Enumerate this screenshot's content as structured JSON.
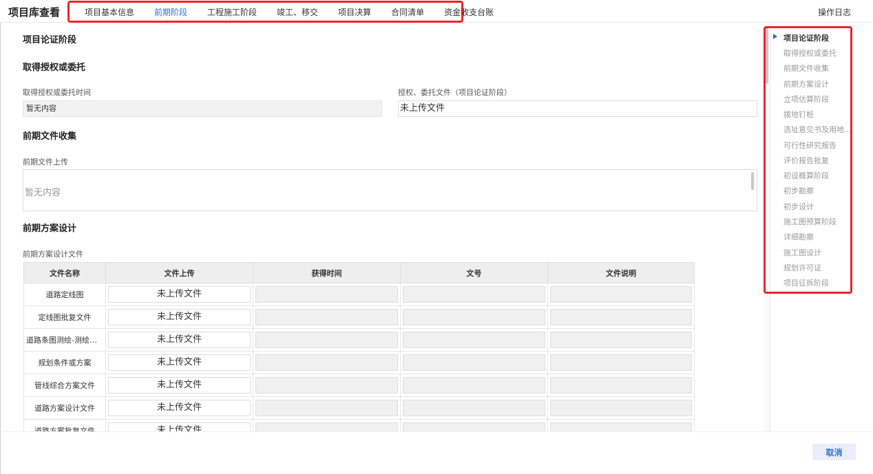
{
  "header": {
    "title": "项目库查看",
    "tabs": [
      {
        "label": "项目基本信息",
        "active": false
      },
      {
        "label": "前期阶段",
        "active": true
      },
      {
        "label": "工程施工阶段",
        "active": false
      },
      {
        "label": "竣工、移交",
        "active": false
      },
      {
        "label": "项目决算",
        "active": false
      },
      {
        "label": "合同清单",
        "active": false
      },
      {
        "label": "资金收支台账",
        "active": false
      }
    ],
    "log_link": "操作日志"
  },
  "main": {
    "section_1": "项目论证阶段",
    "section_2": "取得授权或委托",
    "auth_time_label": "取得授权或委托时间",
    "auth_time_value": "暂无内容",
    "auth_file_label": "授权、委托文件（项目论证阶段）",
    "auth_file_value": "未上传文件",
    "section_3": "前期文件收集",
    "prefile_label": "前期文件上传",
    "prefile_value": "暂无内容",
    "section_4": "前期方案设计",
    "design_file_label": "前期方案设计文件",
    "table": {
      "headers": [
        "文件名称",
        "文件上传",
        "获得时间",
        "文号",
        "文件说明"
      ],
      "upload_text": "未上传文件",
      "rows": [
        "道路定线图",
        "定线图批复文件",
        "道路条图测绘-测绘报...",
        "规划条件或方案",
        "管线综合方案文件",
        "道路方案设计文件",
        "道路方案批复文件"
      ]
    }
  },
  "right_nav": {
    "items": [
      {
        "label": "项目论证阶段",
        "active": true
      },
      {
        "label": "取得授权或委托",
        "active": false
      },
      {
        "label": "前期文件收集",
        "active": false
      },
      {
        "label": "前期方案设计",
        "active": false
      },
      {
        "label": "立项估算阶段",
        "active": false
      },
      {
        "label": "拨地钉桩",
        "active": false
      },
      {
        "label": "选址意见书及用地...",
        "active": false
      },
      {
        "label": "可行性研究报告",
        "active": false
      },
      {
        "label": "评价报告批复",
        "active": false
      },
      {
        "label": "初设概算阶段",
        "active": false
      },
      {
        "label": "初步勘察",
        "active": false
      },
      {
        "label": "初步设计",
        "active": false
      },
      {
        "label": "施工图预算阶段",
        "active": false
      },
      {
        "label": "详细勘察",
        "active": false
      },
      {
        "label": "施工图设计",
        "active": false
      },
      {
        "label": "规划许可证",
        "active": false
      },
      {
        "label": "项目征拆阶段",
        "active": false
      }
    ]
  },
  "footer": {
    "cancel_label": "取消"
  },
  "colors": {
    "accent": "#2b6fd6",
    "highlight_border": "#e8262a"
  }
}
